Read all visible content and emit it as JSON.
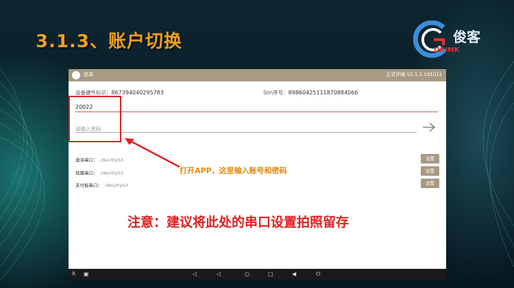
{
  "slide": {
    "title": "3.1.3、账户切换"
  },
  "logo": {
    "text": "俊客",
    "sub": "DRIMK",
    "colors": {
      "ring": "#3a8fd8",
      "accent": "#e53030"
    }
  },
  "app": {
    "topbar": {
      "title": "登录",
      "env": "正式环境 V2.1.2.191011"
    },
    "device": {
      "hw_label": "设备硬件标识：",
      "hw_value": "867394040295783",
      "sim_label": "Sim序号：",
      "sim_value": "89860425111870884066"
    },
    "account_value": "20022",
    "password_placeholder": "请输入密码",
    "ports": [
      {
        "label": "速溶串口：",
        "value": "/dev/ttyS3",
        "button": "设置"
      },
      {
        "label": "现磨串口：",
        "value": "/dev/ttyS1",
        "button": "设置"
      },
      {
        "label": "支付板串口：",
        "value": "/dev/ttyS4",
        "button": "设置"
      }
    ]
  },
  "annotations": {
    "arrow_text": "打开APP，这里输入账号和密码",
    "notice": "注意：建议将此处的串口设置拍照留存"
  },
  "colors": {
    "title": "#f0a020",
    "highlight": "#e02020",
    "topbar": "#a89a82"
  }
}
